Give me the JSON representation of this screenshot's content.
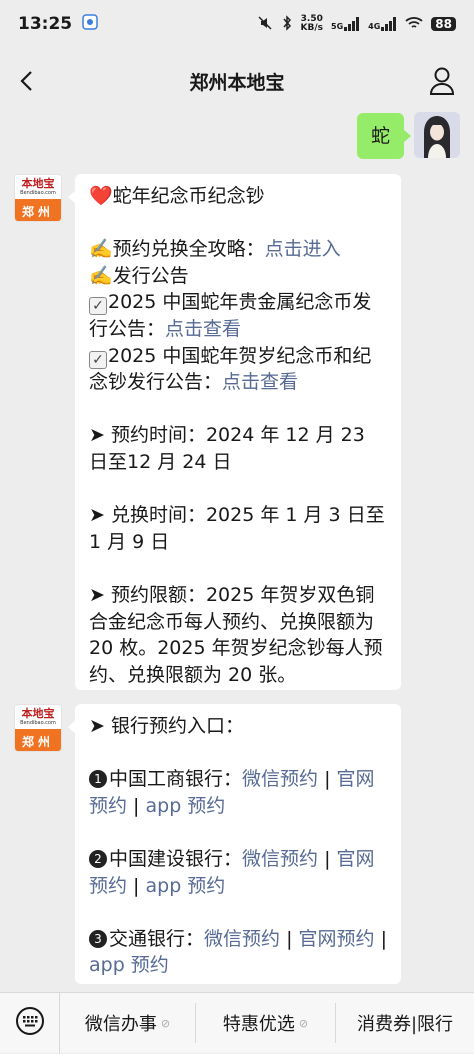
{
  "status": {
    "time": "13:25",
    "net_speed": "3.50",
    "net_unit": "KB/s",
    "sig1": "5G",
    "sig2": "4G",
    "battery": "88"
  },
  "nav": {
    "title": "郑州本地宝",
    "back_icon": "back-arrow-icon",
    "user_icon": "person-icon"
  },
  "me": {
    "message": "蛇"
  },
  "bot": {
    "brand": "本地宝",
    "url": "Bendibao.com",
    "city": "郑州"
  },
  "msg1": {
    "heading": "❤️蛇年纪念币纪念钞",
    "l1_text": "✍️预约兑换全攻略：",
    "l1_link": "点击进入",
    "l2_text": "✍️发行公告",
    "l3_text": "2025 中国蛇年贵金属纪念币发行公告：",
    "l3_link": "点击查看",
    "l4_text": "2025 中国蛇年贺岁纪念币和纪念钞发行公告：",
    "l4_link": "点击查看",
    "p1": "➤ 预约时间：2024 年 12 月 23 日至12 月 24 日",
    "p2": "➤ 兑换时间：2025 年 1 月 3 日至 1 月 9 日",
    "p3": "➤ 预约限额：2025 年贺岁双色铜合金纪念币每人预约、兑换限额为 20 枚。2025 年贺岁纪念钞每人预约、兑换限额为 20 张。"
  },
  "msg2": {
    "heading": "➤ 银行预约入口：",
    "banks": [
      {
        "num": "1",
        "name": "中国工商银行：",
        "wx": "微信预约",
        "sep1": " | ",
        "site": "官网预约",
        "sep2": " | ",
        "app": "app 预约"
      },
      {
        "num": "2",
        "name": "中国建设银行：",
        "wx": "微信预约",
        "sep1": " | ",
        "site": "官网预约",
        "sep2": " | ",
        "app": "app 预约"
      },
      {
        "num": "3",
        "name": "交通银行：",
        "wx": "微信预约",
        "sep1": " | ",
        "site": "官网预约",
        "sep2": " | ",
        "app": "app 预约"
      }
    ]
  },
  "menu": {
    "keyboard_icon": "keyboard-icon",
    "items": [
      "微信办事",
      "特惠优选",
      "消费券|限行"
    ]
  }
}
